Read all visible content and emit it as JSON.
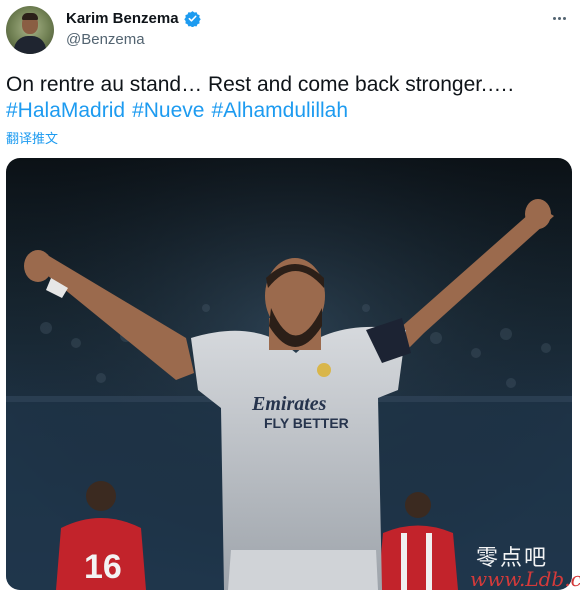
{
  "profile": {
    "display_name": "Karim Benzema",
    "handle": "@Benzema",
    "verified_icon": "verified-badge-icon",
    "verified_color": "#1d9bf0"
  },
  "tweet": {
    "text": "On rentre au stand… Rest and come back stronger.….",
    "hashtags": [
      "#HalaMadrid",
      "#Nueve",
      "#Alhamdulillah"
    ],
    "translate_label": "翻译推文",
    "link_color": "#1d9bf0"
  },
  "media": {
    "jersey_sponsor_line1": "Emirates",
    "jersey_sponsor_line2": "FLY BETTER",
    "opponent_number": "16"
  },
  "watermark": {
    "chinese": "零点吧",
    "url": "www.Ldb.cc"
  }
}
